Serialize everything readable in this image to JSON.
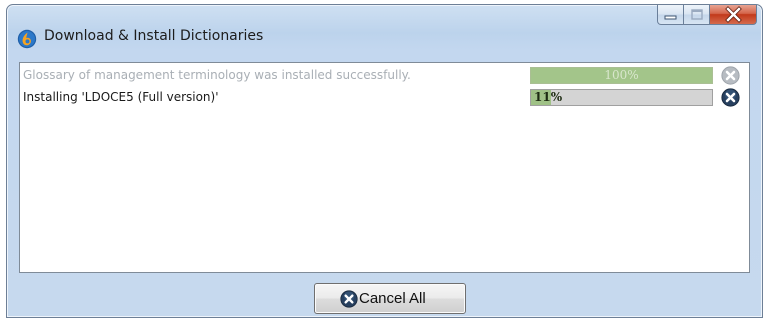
{
  "window": {
    "title": "Download & Install Dictionaries"
  },
  "caption_buttons": {
    "minimize_icon": "minimize-icon",
    "maximize_icon": "maximize-icon",
    "close_icon": "close-x-icon"
  },
  "downloads": [
    {
      "label": "Glossary of management terminology was installed successfully.",
      "progress_percent": 100,
      "progress_text": "100%",
      "status": "completed",
      "cancel_icon": "cancel-circle-icon"
    },
    {
      "label": "Installing 'LDOCE5 (Full version)'",
      "progress_percent": 11,
      "progress_text": "11%",
      "status": "in-progress",
      "cancel_icon": "cancel-circle-icon"
    }
  ],
  "footer": {
    "cancel_all_label": "Cancel All",
    "cancel_all_icon": "cancel-circle-icon"
  },
  "colors": {
    "progress_fill": "#9fc186",
    "progress_track": "#d4d4d4",
    "cancel_icon_dark": "#27405f",
    "close_button": "#c2391a"
  }
}
